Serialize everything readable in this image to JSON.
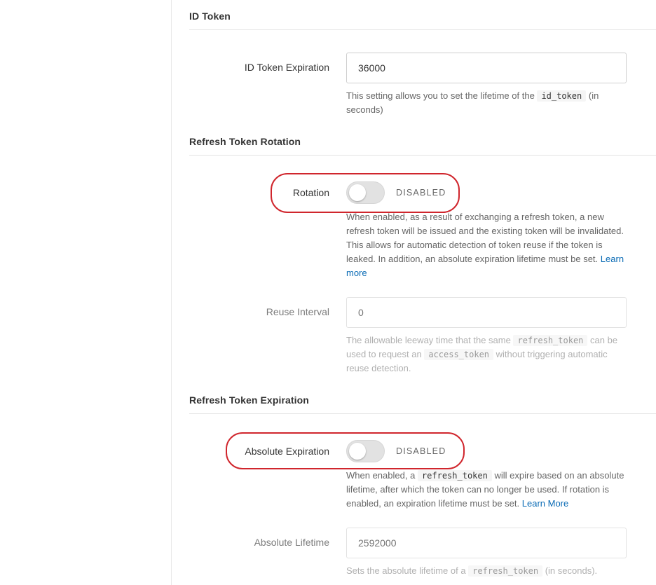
{
  "id_token": {
    "section_title": "ID Token",
    "expiration_label": "ID Token Expiration",
    "expiration_value": "36000",
    "help_prefix": "This setting allows you to set the lifetime of the",
    "help_code": "id_token",
    "help_suffix": "(in seconds)"
  },
  "rotation": {
    "section_title": "Refresh Token Rotation",
    "toggle_label": "Rotation",
    "toggle_state": "DISABLED",
    "toggle_on": false,
    "help_text": "When enabled, as a result of exchanging a refresh token, a new refresh token will be issued and the existing token will be invalidated. This allows for automatic detection of token reuse if the token is leaked. In addition, an absolute expiration lifetime must be set.",
    "learn_more": "Learn more",
    "reuse_label": "Reuse Interval",
    "reuse_placeholder": "0",
    "reuse_help_1": "The allowable leeway time that the same",
    "reuse_help_code1": "refresh_token",
    "reuse_help_2": "can be used to request an",
    "reuse_help_code2": "access_token",
    "reuse_help_3": "without triggering automatic reuse detection."
  },
  "expiration": {
    "section_title": "Refresh Token Expiration",
    "toggle_label": "Absolute Expiration",
    "toggle_state": "DISABLED",
    "toggle_on": false,
    "help_1": "When enabled, a",
    "help_code": "refresh_token",
    "help_2": "will expire based on an absolute lifetime, after which the token can no longer be used. If rotation is enabled, an expiration lifetime must be set.",
    "learn_more": "Learn More",
    "lifetime_label": "Absolute Lifetime",
    "lifetime_placeholder": "2592000",
    "lifetime_help_1": "Sets the absolute lifetime of a",
    "lifetime_help_code": "refresh_token",
    "lifetime_help_2": "(in seconds)."
  },
  "colors": {
    "highlight": "#d0262d",
    "link": "#0a6bb5"
  }
}
